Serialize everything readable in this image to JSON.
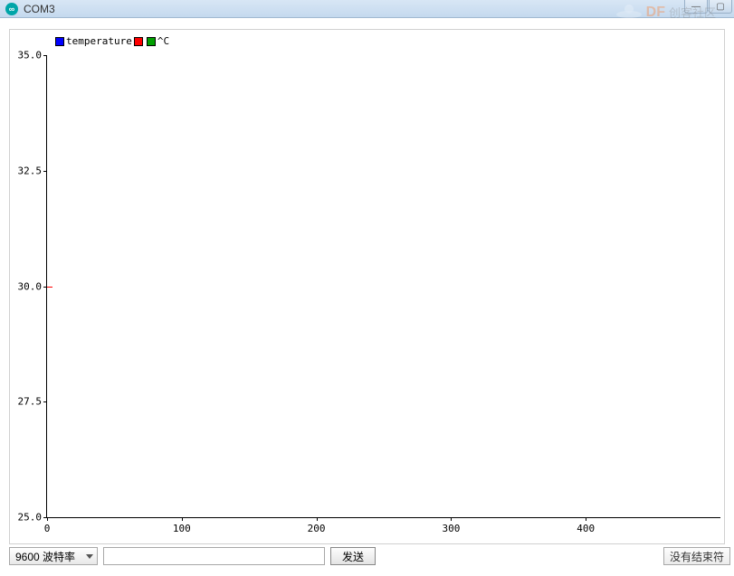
{
  "window": {
    "title": "COM3",
    "icon_glyph": "∞"
  },
  "watermark": {
    "df": "DF",
    "text": "创客社区"
  },
  "legend": {
    "series1": {
      "color": "#0000ff",
      "label": "temperature"
    },
    "series2": {
      "color": "#ff0000",
      "label": ""
    },
    "series3": {
      "color": "#00a000",
      "label": "^C"
    }
  },
  "chart_data": {
    "type": "line",
    "title": "",
    "xlabel": "",
    "ylabel": "",
    "xlim": [
      0,
      500
    ],
    "ylim": [
      25.0,
      35.0
    ],
    "x_ticks": [
      0,
      100,
      200,
      300,
      400
    ],
    "y_ticks": [
      25.0,
      27.5,
      30.0,
      32.5,
      35.0
    ],
    "series": [
      {
        "name": "temperature",
        "color": "#0000ff",
        "x": [],
        "y": []
      },
      {
        "name": "",
        "color": "#ff0000",
        "x": [
          0
        ],
        "y": [
          30.0
        ]
      },
      {
        "name": "^C",
        "color": "#00a000",
        "x": [],
        "y": []
      }
    ]
  },
  "controls": {
    "baud_select": "9600 波特率",
    "send_input": "",
    "send_button": "发送",
    "status_right": "没有结束符"
  }
}
